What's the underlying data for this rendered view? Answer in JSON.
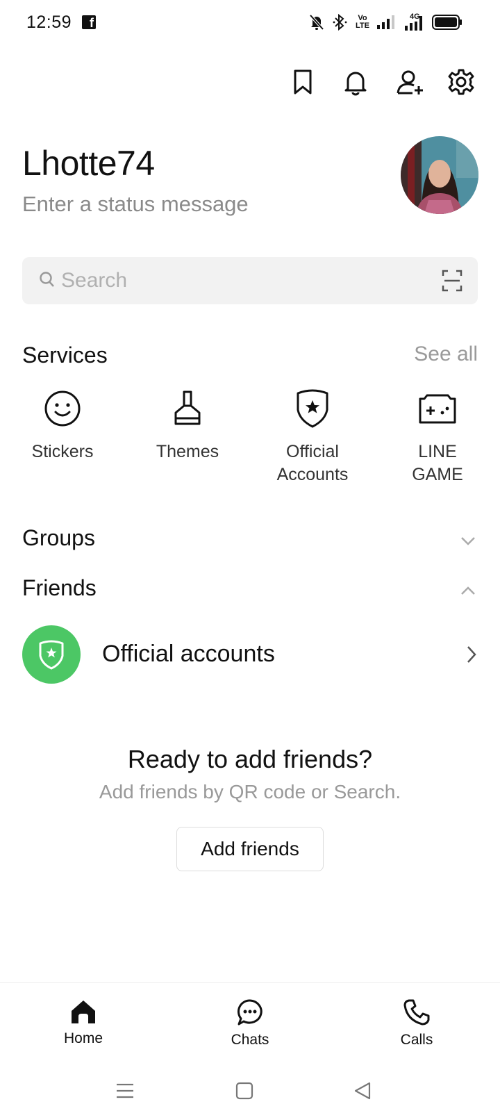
{
  "status_bar": {
    "time": "12:59",
    "app_badge": "f",
    "volte_label_top": "Vo",
    "volte_label_bottom": "LTE",
    "network_label": "4G"
  },
  "profile": {
    "name": "Lhotte74",
    "status_placeholder": "Enter a status message"
  },
  "search": {
    "placeholder": "Search"
  },
  "services": {
    "title": "Services",
    "see_all": "See all",
    "items": [
      {
        "line1": "Stickers",
        "line2": "",
        "icon": "smiley-icon"
      },
      {
        "line1": "Themes",
        "line2": "",
        "icon": "brush-icon"
      },
      {
        "line1": "Official",
        "line2": "Accounts",
        "icon": "shield-star-icon"
      },
      {
        "line1": "LINE",
        "line2": "GAME",
        "icon": "gamepad-icon"
      }
    ]
  },
  "groups": {
    "title": "Groups"
  },
  "friends": {
    "title": "Friends",
    "official_accounts_label": "Official accounts"
  },
  "empty_state": {
    "title": "Ready to add friends?",
    "subtitle": "Add friends by QR code or Search.",
    "button": "Add friends"
  },
  "bottom_nav": {
    "items": [
      {
        "label": "Home",
        "icon": "home-icon",
        "active": true
      },
      {
        "label": "Chats",
        "icon": "chat-bubble-icon",
        "active": false
      },
      {
        "label": "Calls",
        "icon": "phone-icon",
        "active": false
      }
    ]
  },
  "colors": {
    "accent_green": "#4cc765",
    "text_primary": "#111111",
    "text_secondary": "#8a8a8a",
    "search_bg": "#f2f2f2"
  }
}
